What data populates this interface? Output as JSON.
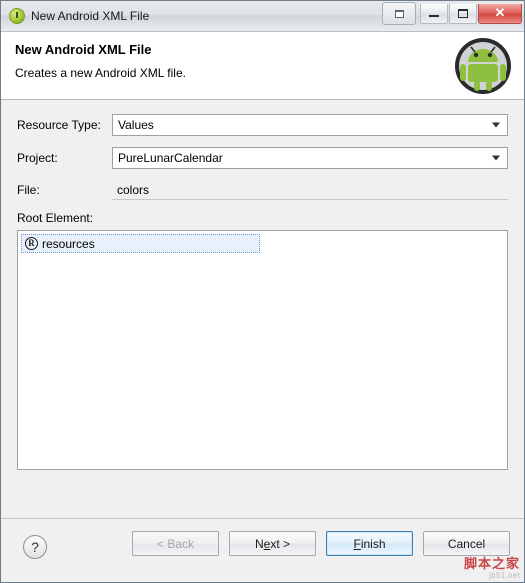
{
  "window": {
    "title": "New Android XML File",
    "title_icon": "android-circle-icon",
    "buttons": {
      "restore_group": "restore-group-icon",
      "minimize": "minimize-icon",
      "maximize": "maximize-icon",
      "close": "✕"
    }
  },
  "header": {
    "title": "New Android XML File",
    "description": "Creates a new Android XML file.",
    "logo": "android-robot-logo"
  },
  "form": {
    "resource_type": {
      "label": "Resource Type:",
      "value": "Values"
    },
    "project": {
      "label": "Project:",
      "value": "PureLunarCalendar"
    },
    "file": {
      "label": "File:",
      "value": "colors",
      "placeholder": ""
    },
    "root_element": {
      "label": "Root Element:",
      "items": [
        {
          "icon": "R",
          "label": "resources",
          "selected": true
        }
      ]
    }
  },
  "footer": {
    "help": "?",
    "back": "< Back",
    "next_prefix": "N",
    "next_underline": "e",
    "next_suffix": "xt >",
    "finish_prefix": "",
    "finish_underline": "F",
    "finish_suffix": "inish",
    "cancel": "Cancel"
  },
  "watermark": {
    "main": "脚本之家",
    "sub": "jb51.net"
  }
}
